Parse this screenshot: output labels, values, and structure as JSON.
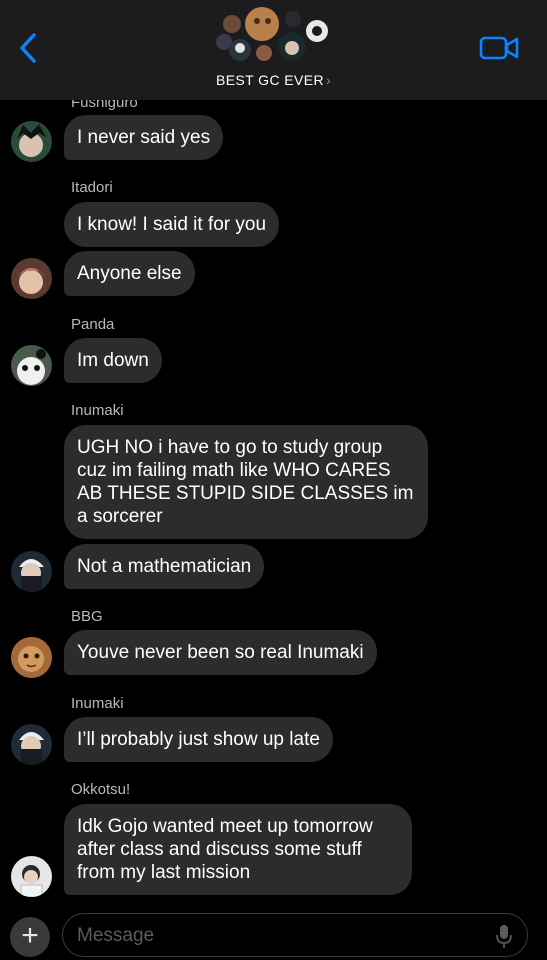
{
  "header": {
    "title": "BEST GC EVER",
    "chevron": "›",
    "back_icon": "chevron-left-icon",
    "video_icon": "video-camera-icon",
    "accent_color": "#0a84ff"
  },
  "messages": [
    {
      "sender": "Fushiguro",
      "text": "I never said yes"
    },
    {
      "sender": "Itadori",
      "text": "I know! I said it for you"
    },
    {
      "text": "Anyone else"
    },
    {
      "sender": "Panda",
      "text": "Im down"
    },
    {
      "sender": "Inumaki",
      "text": "UGH NO i have to go to study group cuz im failing math like WHO CARES AB THESE STUPID SIDE CLASSES im a sorcerer"
    },
    {
      "text": "Not a mathematician"
    },
    {
      "sender": "BBG",
      "text": "Youve never been so real Inumaki"
    },
    {
      "sender": "Inumaki",
      "text": "I’ll probably just show up late"
    },
    {
      "sender": "Okkotsu!",
      "text": "Idk Gojo wanted meet up tomorrow after class and discuss some stuff from my last mission"
    }
  ],
  "composer": {
    "placeholder": "Message",
    "plus_label": "+",
    "mic_icon": "microphone-icon"
  },
  "colors": {
    "bubble": "#2c2c2e",
    "header": "#1c1c1e",
    "background": "#000000"
  }
}
